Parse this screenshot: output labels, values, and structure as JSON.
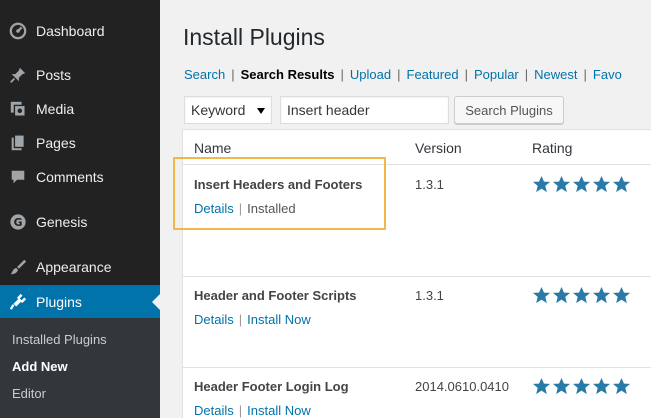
{
  "sidebar": {
    "items": [
      {
        "label": "Dashboard",
        "icon": "dashboard-icon"
      },
      {
        "label": "Posts",
        "icon": "pushpin-icon"
      },
      {
        "label": "Media",
        "icon": "media-icon"
      },
      {
        "label": "Pages",
        "icon": "pages-icon"
      },
      {
        "label": "Comments",
        "icon": "comment-icon"
      },
      {
        "label": "Genesis",
        "icon": "genesis-icon"
      },
      {
        "label": "Appearance",
        "icon": "paintbrush-icon"
      },
      {
        "label": "Plugins",
        "icon": "plugin-icon",
        "active": true
      }
    ],
    "submenu": [
      "Installed Plugins",
      "Add New",
      "Editor"
    ],
    "current_submenu": "Add New"
  },
  "page": {
    "title": "Install Plugins",
    "filters": [
      "Search",
      "Search Results",
      "Upload",
      "Featured",
      "Popular",
      "Newest",
      "Favo"
    ],
    "current_filter": "Search Results"
  },
  "search": {
    "type_selected": "Keyword",
    "query": "Insert header",
    "button_label": "Search Plugins"
  },
  "table": {
    "headers": {
      "name": "Name",
      "version": "Version",
      "rating": "Rating"
    },
    "rows": [
      {
        "name": "Insert Headers and Footers",
        "version": "1.3.1",
        "action1": "Details",
        "action2": "Installed",
        "stars": 5
      },
      {
        "name": "Header and Footer Scripts",
        "version": "1.3.1",
        "action1": "Details",
        "action2": "Install Now",
        "stars": 5
      },
      {
        "name": "Header Footer Login Log",
        "version": "2014.0610.0410",
        "action1": "Details",
        "action2": "Install Now",
        "stars": 5
      }
    ]
  },
  "colors": {
    "accent": "#0073aa",
    "sidebar": "#222222",
    "highlight": "#f0b849",
    "star": "#2a7aa8"
  }
}
